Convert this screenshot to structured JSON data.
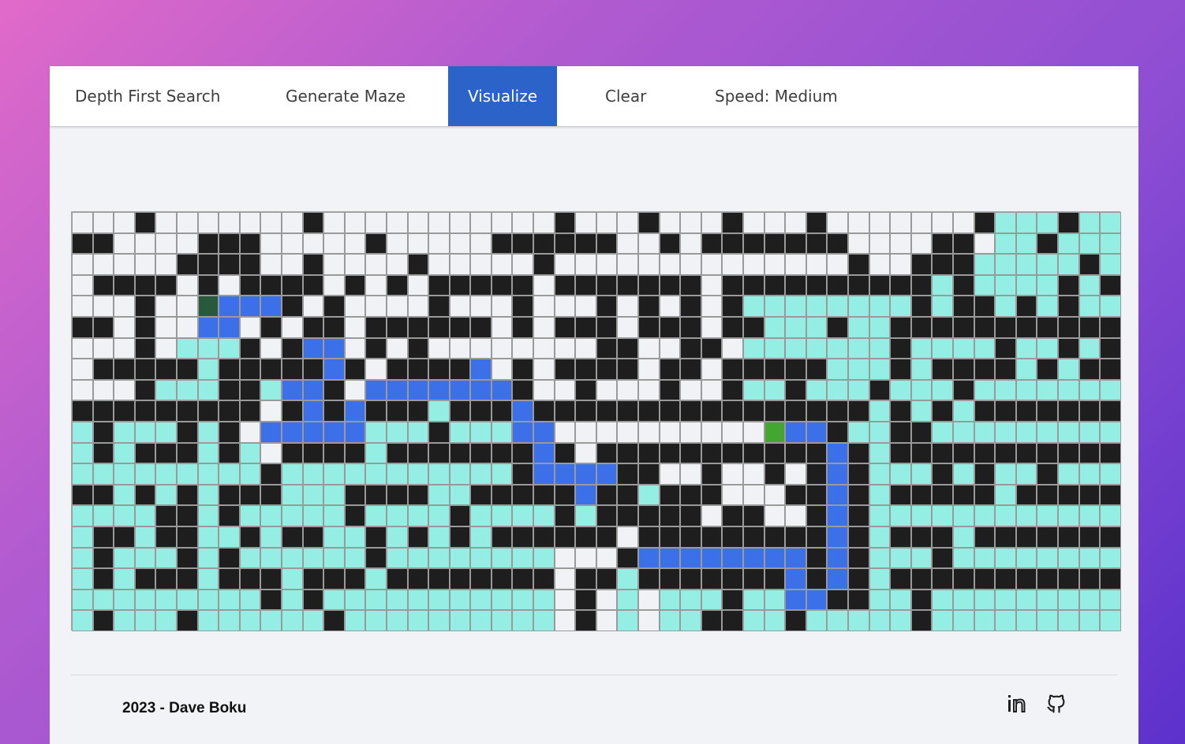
{
  "navbar": {
    "algorithm_label": "Depth First Search",
    "generate_label": "Generate Maze",
    "visualize_label": "Visualize",
    "clear_label": "Clear",
    "speed_label": "Speed: Medium"
  },
  "footer": {
    "credit": "2023 - Dave Boku",
    "icons": [
      "linkedin-icon",
      "github-icon"
    ]
  },
  "colors": {
    "unvisited": "#f1f2f5",
    "wall": "#1e1e1e",
    "visited": "#95eee4",
    "path": "#3b70e8",
    "start": "#275a3c",
    "end": "#42a631",
    "accent": "#2c63c9"
  },
  "maze": {
    "cols": 50,
    "rows": 20,
    "legend": "0=unvisited,1=wall,2=visited,3=path,4=start,5=end",
    "cells": [
      "00010000000100000000000100010001000100000001222122222",
      "11000011100000100000111111001011111110000110221222221",
      "00000111100100001000001000000000000001001112222212222",
      "01111010111101010111110111111101111111111212222121222",
      "00010043331010000100010001010101222222221211212122222",
      "11010033010110111111010111011101122212211111111111121",
      "00010222101330101000000001100110222222212222122121221",
      "01111121111131011113010111101101111122212111121211121",
      "00012221123310333333310010001001221222122212222222222",
      "11111111101313111211131111111111111111212121111111111",
      "21222121033333222122233000000000053312211222222222222",
      "21211121201111211111113101111111111131211111111111121",
      "22222222212222222222213333110010010131222121221222222",
      "11212121112221111221111131121110001131211111211111121",
      "22221121222221222212222121111101100131222222222222222",
      "21121122121122121212111111011111111131211121111111211",
      "21222121222222122222222000133333333131222122222222222",
      "21211121112111211111111011211111113131211111111111121",
      "22222222212122222222222010202221223311221222222222222",
      "21222122222212222222222010202211221222221222222222222"
    ]
  }
}
